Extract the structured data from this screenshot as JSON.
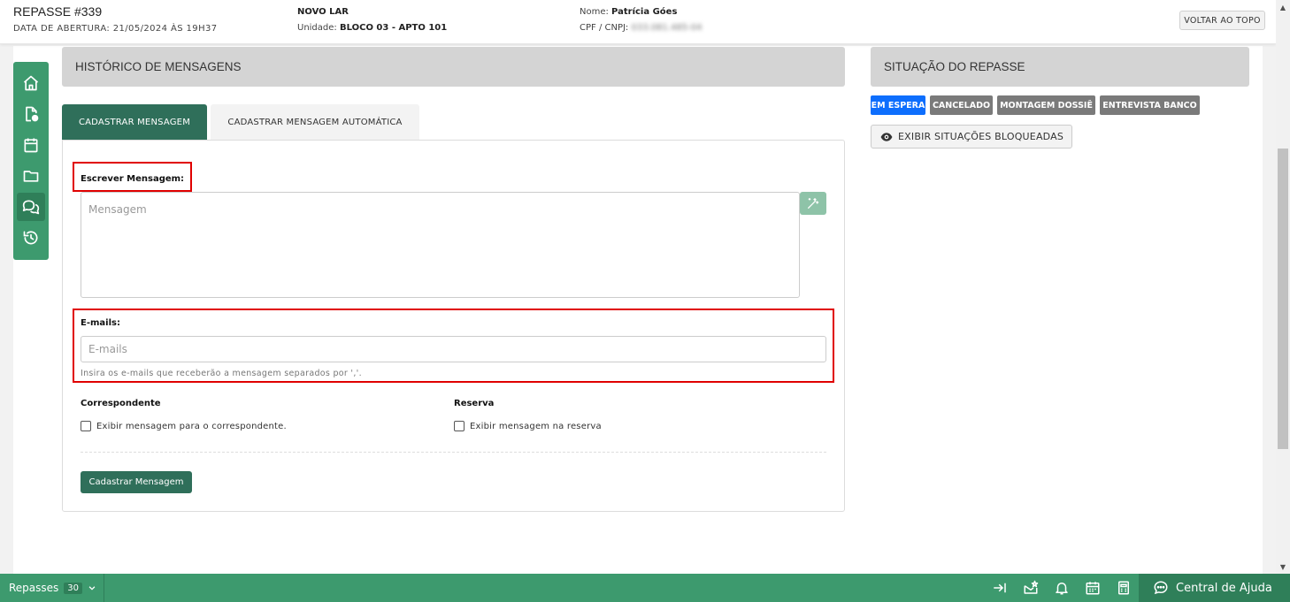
{
  "header": {
    "title": "REPASSE #339",
    "opened_label": "DATA DE ABERTURA: 21/05/2024 ÀS 19H37",
    "project": "NOVO LAR",
    "unit_label": "Unidade: ",
    "unit_value": "BLOCO 03 - APTO 101",
    "name_label": "Nome: ",
    "name_value": "Patrícia Góes",
    "cpf_label": "CPF / CNPJ: ",
    "cpf_value": "033.081.485-04",
    "back_top": "VOLTAR AO TOPO"
  },
  "sidebar": {
    "items": [
      {
        "icon": "home-icon"
      },
      {
        "icon": "file-search-icon"
      },
      {
        "icon": "calendar-icon"
      },
      {
        "icon": "folder-icon"
      },
      {
        "icon": "chat-icon",
        "active": true
      },
      {
        "icon": "history-icon"
      }
    ]
  },
  "messages": {
    "panel_title": "HISTÓRICO DE MENSAGENS",
    "tabs": [
      "CADASTRAR MENSAGEM",
      "CADASTRAR MENSAGEM AUTOMÁTICA"
    ],
    "write_label": "Escrever Mensagem:",
    "message_placeholder": "Mensagem",
    "emails_label": "E-mails:",
    "emails_placeholder": "E-mails",
    "emails_help": "Insira os e-mails que receberão a mensagem separados por ','.",
    "correspondent_title": "Correspondente",
    "correspondent_check": "Exibir mensagem para o correspondente.",
    "reserve_title": "Reserva",
    "reserve_check": "Exibir mensagem na reserva",
    "submit": "Cadastrar Mensagem"
  },
  "status": {
    "panel_title": "SITUAÇÃO DO REPASSE",
    "badges": [
      {
        "label": "EM ESPERA",
        "color": "#0d6efd"
      },
      {
        "label": "CANCELADO",
        "color": "#7a7a7a"
      },
      {
        "label": "MONTAGEM DOSSIÊ",
        "color": "#7a7a7a"
      },
      {
        "label": "ENTREVISTA BANCO",
        "color": "#7a7a7a"
      }
    ],
    "show_blocked": "EXIBIR SITUAÇÕES BLOQUEADAS"
  },
  "bottom_bar": {
    "repasses_label": "Repasses",
    "repasses_count": "30",
    "help_label": "Central de Ajuda"
  },
  "colors": {
    "primary_green": "#3d9a6e",
    "dark_green": "#2f6f5a",
    "accent_blue": "#0d6efd",
    "highlight_red": "#e00000"
  }
}
